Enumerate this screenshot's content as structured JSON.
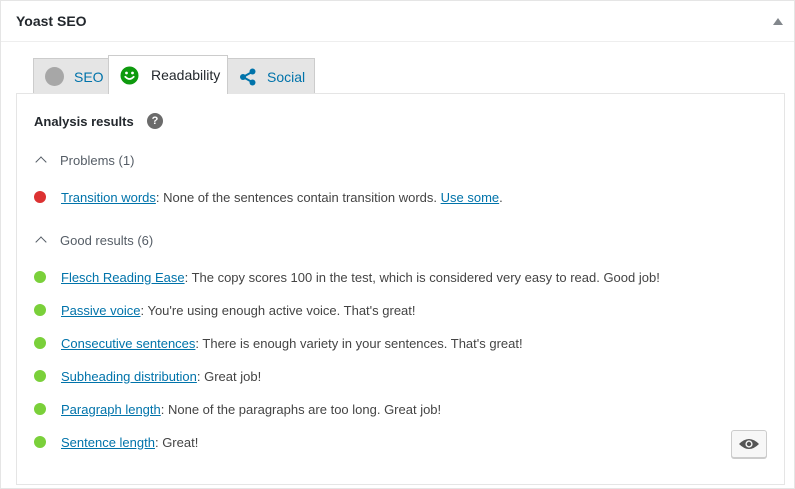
{
  "panel": {
    "title": "Yoast SEO"
  },
  "tabs": [
    {
      "label": "SEO",
      "icon": "gray-circle-icon",
      "active": false
    },
    {
      "label": "Readability",
      "icon": "smiley-face-icon",
      "active": true
    },
    {
      "label": "Social",
      "icon": "share-icon",
      "active": false
    }
  ],
  "analysis": {
    "heading": "Analysis results",
    "help_icon": "?",
    "problems": {
      "label": "Problems (1)",
      "items": [
        {
          "link": "Transition words",
          "text": ": None of the sentences contain transition words. ",
          "extra_link": "Use some",
          "extra_text": "."
        }
      ]
    },
    "good": {
      "label": "Good results (6)",
      "items": [
        {
          "link": "Flesch Reading Ease",
          "text": ": The copy scores 100 in the test, which is considered very easy to read. Good job!"
        },
        {
          "link": "Passive voice",
          "text": ": You're using enough active voice. That's great!"
        },
        {
          "link": "Consecutive sentences",
          "text": ": There is enough variety in your sentences. That's great!"
        },
        {
          "link": "Subheading distribution",
          "text": ": Great job!"
        },
        {
          "link": "Paragraph length",
          "text": ": None of the paragraphs are too long. Great job!"
        },
        {
          "link": "Sentence length",
          "text": ": Great!"
        }
      ]
    }
  },
  "colors": {
    "accent": "#0073aa",
    "problem": "#dc3232",
    "good": "#7ad03a",
    "smiley": "#0e9a0e"
  }
}
